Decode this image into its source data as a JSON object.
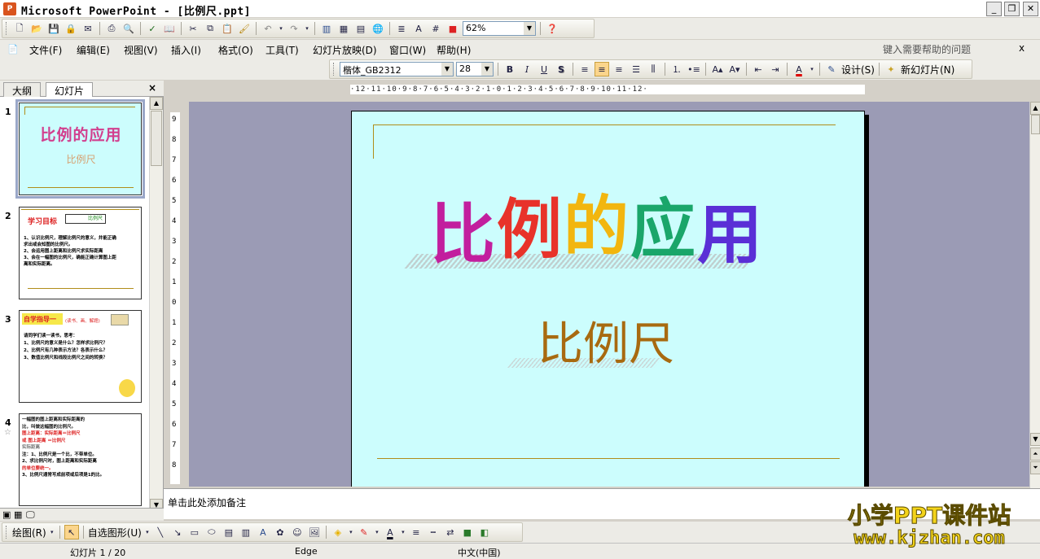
{
  "window": {
    "title": "Microsoft PowerPoint - [比例尺.ppt]",
    "app_icon_text": "P"
  },
  "standard_toolbar": {
    "zoom": "62%"
  },
  "menubar": {
    "items": [
      "文件(F)",
      "编辑(E)",
      "视图(V)",
      "插入(I)",
      "格式(O)",
      "工具(T)",
      "幻灯片放映(D)",
      "窗口(W)",
      "帮助(H)"
    ],
    "help_placeholder": "键入需要帮助的问题",
    "close_x": "x"
  },
  "format_toolbar": {
    "font": "楷体_GB2312",
    "size": "28",
    "bold": "B",
    "italic": "I",
    "underline": "U",
    "shadow": "S",
    "design_label": "设计(S)",
    "new_slide_label": "新幻灯片(N)"
  },
  "left_pane": {
    "tabs": [
      "大纲",
      "幻灯片"
    ],
    "close_x": "×",
    "slides": [
      {
        "number": "1",
        "title": "比例的应用",
        "subtitle": "比例尺"
      },
      {
        "number": "2",
        "heading": "学习目标",
        "arrow_text": "比例尺",
        "lines": [
          "1、认识比例尺，理解比例尺的意义，并能正确",
          "求出或会知图的比例尺。",
          "2、会运用图上距离和比例尺求实际距离",
          "3、会在一幅图的比例尺，确能正确计算图上距",
          "离和实际距离。"
        ]
      },
      {
        "number": "3",
        "heading": "自学指导一",
        "side_note": "(读书、画、解题)",
        "lines": [
          "请同学们读一读书，思考：",
          "1、比例尺的意义是什么？怎样求比例尺？",
          "2、比例尺有几种表示方法？各表示什么？",
          "3、数值比例尺和线段比例尺之间的转换？"
        ]
      },
      {
        "number": "4",
        "star": "☆",
        "lines": [
          "一幅图的图上距离和实际距离的",
          "比，叫做这幅图的比例尺。",
          "图上距离：实际距离＝比例尺",
          "或  图上距离 ＝比例尺",
          "    实际距离",
          "注：1、比例尺是一个比，不带单位。",
          "2、求比例尺时，图上距离和实际距离",
          "的单位要统一。",
          "3、比例尺通常写成前项或后项是1的比。"
        ]
      }
    ]
  },
  "ruler": {
    "horizontal": "·12·11·10·9·8·7·6·5·4·3·2·1·0·1·2·3·4·5·6·7·8·9·10·11·12·",
    "vertical": [
      "9",
      "8",
      "7",
      "6",
      "5",
      "4",
      "3",
      "2",
      "1",
      "0",
      "1",
      "2",
      "3",
      "4",
      "5",
      "6",
      "7",
      "8"
    ]
  },
  "slide": {
    "title_chars": [
      "比",
      "例",
      "的",
      "应",
      "用"
    ],
    "title_colors": [
      "#c21f9e",
      "#e8322a",
      "#f2b60f",
      "#1aa66a",
      "#5a2fd6"
    ],
    "subtitle": "比例尺",
    "subtitle_color": "#a86a10",
    "background": "#ccfdfd"
  },
  "notes": {
    "placeholder": "单击此处添加备注"
  },
  "drawing_toolbar": {
    "draw_label": "绘图(R)",
    "autoshape_label": "自选图形(U)"
  },
  "statusbar": {
    "slide_pos": "幻灯片 1 / 20",
    "template": "Edge",
    "language": "中文(中国)"
  },
  "watermark": {
    "line1": "小学PPT课件站",
    "line2": "www.kjzhan.com"
  }
}
